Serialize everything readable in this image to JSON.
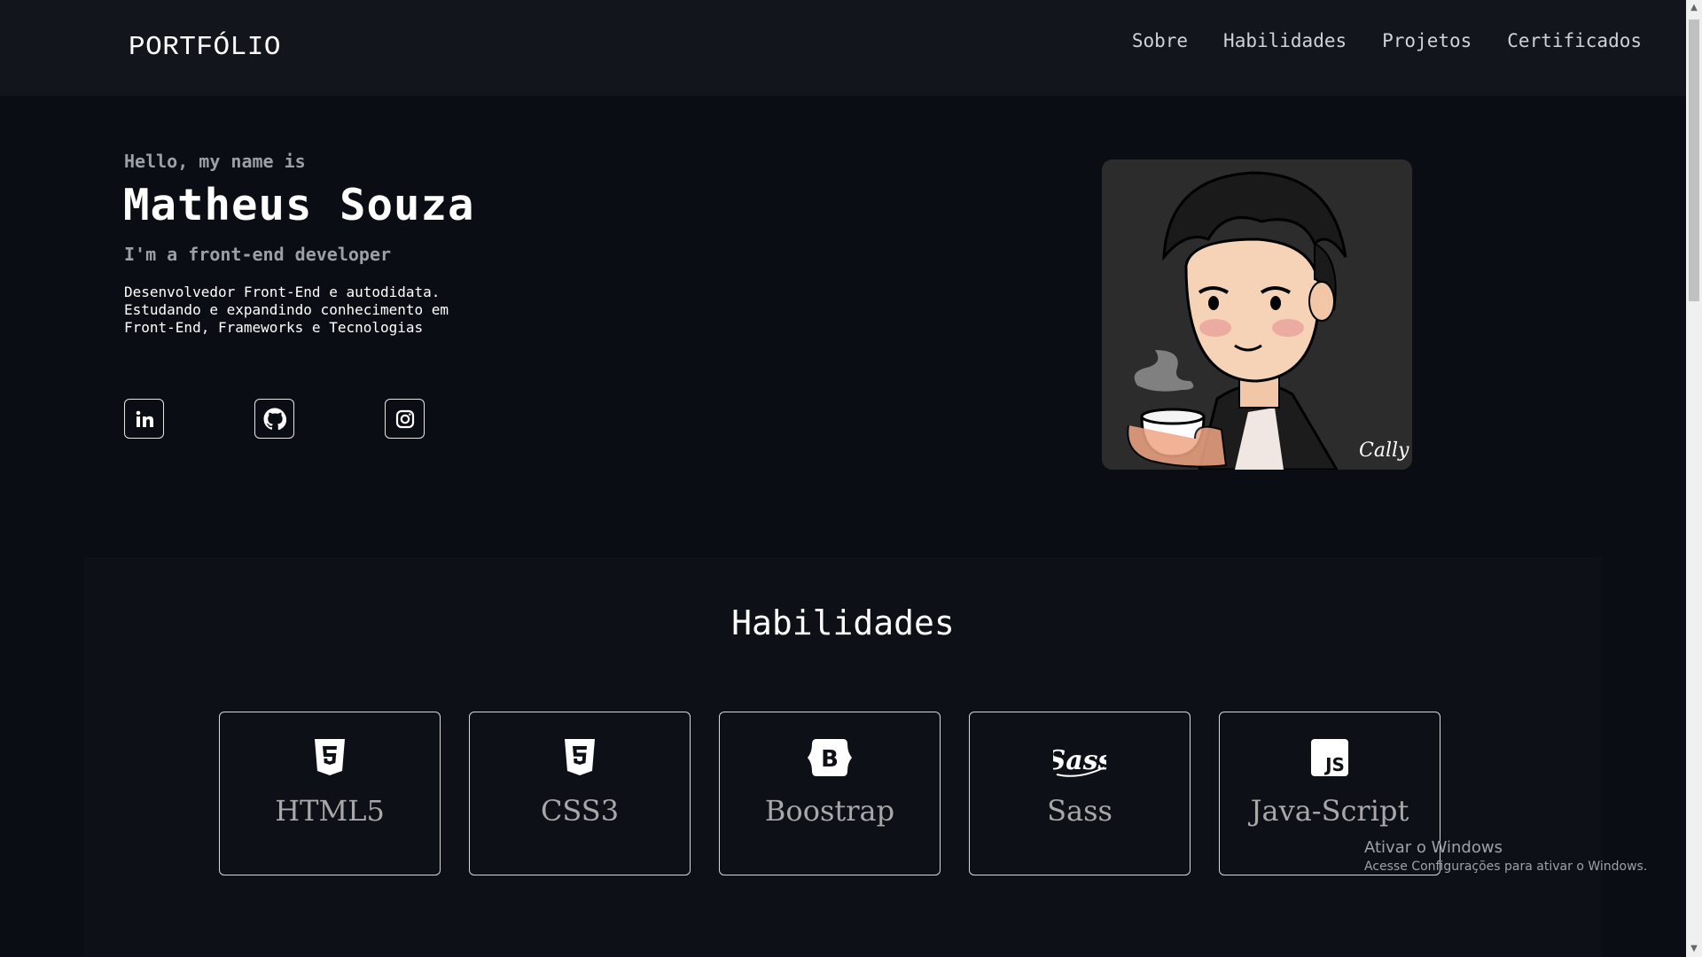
{
  "header": {
    "logo": "PORTFÓLIO",
    "nav": [
      "Sobre",
      "Habilidades",
      "Projetos",
      "Certificados"
    ]
  },
  "hero": {
    "greeting": "Hello, my name is",
    "name": "Matheus Souza",
    "role": "I'm a front-end developer",
    "description": "Desenvolvedor Front-End e autodidata. Estudando e expandindo conhecimento em Front-End, Frameworks e Tecnologias",
    "socials": [
      "linkedin-icon",
      "github-icon",
      "instagram-icon"
    ]
  },
  "skills": {
    "title": "Habilidades",
    "items": [
      {
        "label": "HTML5",
        "icon": "html5-icon"
      },
      {
        "label": "CSS3",
        "icon": "css3-icon"
      },
      {
        "label": "Boostrap",
        "icon": "bootstrap-icon"
      },
      {
        "label": "Sass",
        "icon": "sass-icon"
      },
      {
        "label": "Java-Script",
        "icon": "javascript-icon"
      }
    ]
  },
  "watermark": {
    "title": "Ativar o Windows",
    "subtitle": "Acesse Configurações para ativar o Windows."
  },
  "colors": {
    "background": "#0a0e14",
    "header": "#12161c",
    "section": "#0d1117",
    "text": "#ffffff",
    "muted": "#9aa0a6"
  }
}
